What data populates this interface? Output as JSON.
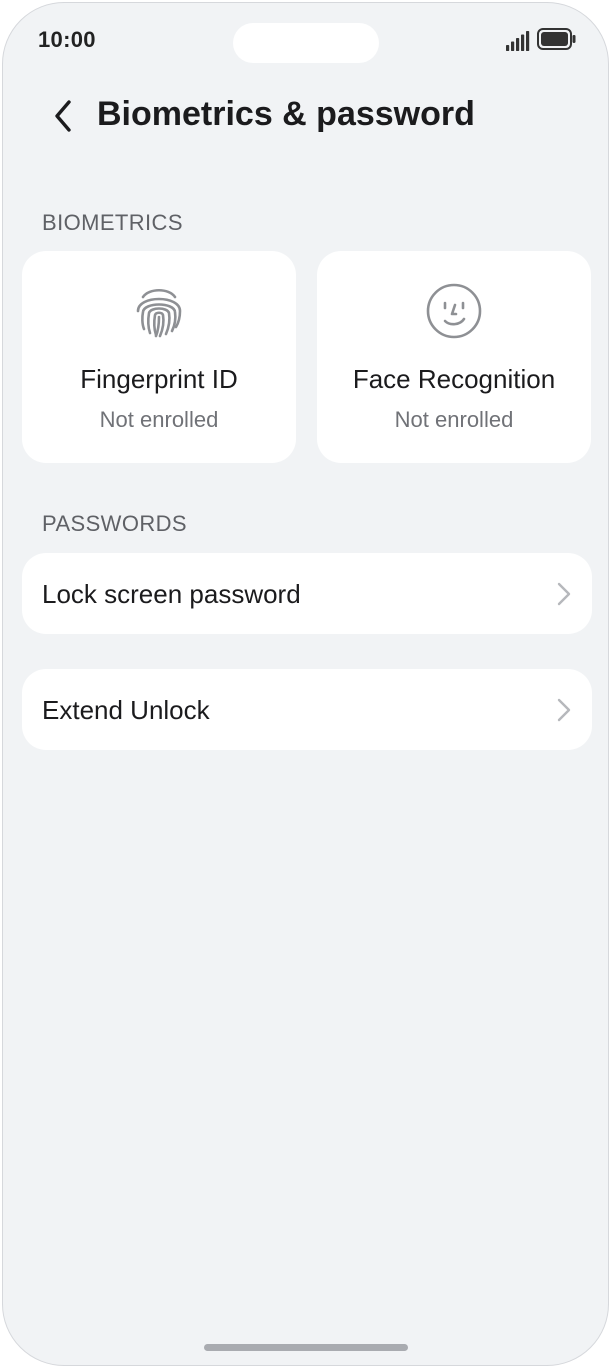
{
  "status_bar": {
    "time": "10:00",
    "signal_icon": "signal-icon",
    "battery_icon": "battery-icon"
  },
  "header": {
    "back_icon": "chevron-left-icon",
    "title": "Biometrics & password"
  },
  "biometrics": {
    "section_title": "BIOMETRICS",
    "cards": [
      {
        "title": "Fingerprint ID",
        "status": "Not enrolled",
        "icon": "fingerprint-icon"
      },
      {
        "title": "Face Recognition",
        "status": "Not enrolled",
        "icon": "face-icon"
      }
    ]
  },
  "passwords": {
    "section_title": "PASSWORDS",
    "items": [
      {
        "label": "Lock screen password",
        "icon": "chevron-right-icon"
      },
      {
        "label": "Extend Unlock",
        "icon": "chevron-right-icon"
      }
    ]
  },
  "colors": {
    "background": "#f1f3f5",
    "card": "#ffffff",
    "primary_text": "#1b1b1d",
    "secondary_text": "#707277",
    "icon_gray": "#8e9094"
  }
}
